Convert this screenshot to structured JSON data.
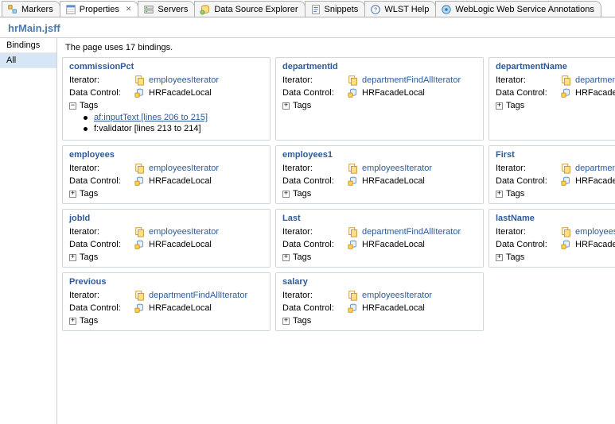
{
  "tabs": [
    {
      "label": "Markers"
    },
    {
      "label": "Properties",
      "active": true
    },
    {
      "label": "Servers"
    },
    {
      "label": "Data Source Explorer"
    },
    {
      "label": "Snippets"
    },
    {
      "label": "WLST Help"
    },
    {
      "label": "WebLogic Web Service Annotations"
    }
  ],
  "page_title": "hrMain.jsff",
  "sidebar": {
    "items": [
      {
        "label": "Bindings",
        "selected": false
      },
      {
        "label": "All",
        "selected": true
      }
    ]
  },
  "summary": "The page uses 17 bindings.",
  "labels": {
    "iterator": "Iterator:",
    "data_control": "Data Control:",
    "tags": "Tags"
  },
  "cards": [
    {
      "title": "commissionPct",
      "iterator": "employeesIterator",
      "data_control": "HRFacadeLocal",
      "tags_expanded": true,
      "tags": [
        {
          "text": "af:inputText [lines 206 to 215]",
          "link": true
        },
        {
          "text": "f:validator [lines 213 to 214]",
          "link": false
        }
      ]
    },
    {
      "title": "departmentId",
      "iterator": "departmentFindAllIterator",
      "data_control": "HRFacadeLocal",
      "tags_expanded": false
    },
    {
      "title": "departmentName",
      "iterator": "departmen",
      "data_control": "HRFacadeLo",
      "tags_expanded": false
    },
    {
      "title": "employees",
      "iterator": "employeesIterator",
      "data_control": "HRFacadeLocal",
      "tags_expanded": false
    },
    {
      "title": "employees1",
      "iterator": "employeesIterator",
      "data_control": "HRFacadeLocal",
      "tags_expanded": false
    },
    {
      "title": "First",
      "iterator": "departmen",
      "data_control": "HRFacadeLo",
      "tags_expanded": false
    },
    {
      "title": "jobId",
      "iterator": "employeesIterator",
      "data_control": "HRFacadeLocal",
      "tags_expanded": false
    },
    {
      "title": "Last",
      "iterator": "departmentFindAllIterator",
      "data_control": "HRFacadeLocal",
      "tags_expanded": false
    },
    {
      "title": "lastName",
      "iterator": "employees",
      "data_control": "HRFacadeLo",
      "tags_expanded": false
    },
    {
      "title": "Previous",
      "iterator": "departmentFindAllIterator",
      "data_control": "HRFacadeLocal",
      "tags_expanded": false
    },
    {
      "title": "salary",
      "iterator": "employeesIterator",
      "data_control": "HRFacadeLocal",
      "tags_expanded": false
    }
  ]
}
